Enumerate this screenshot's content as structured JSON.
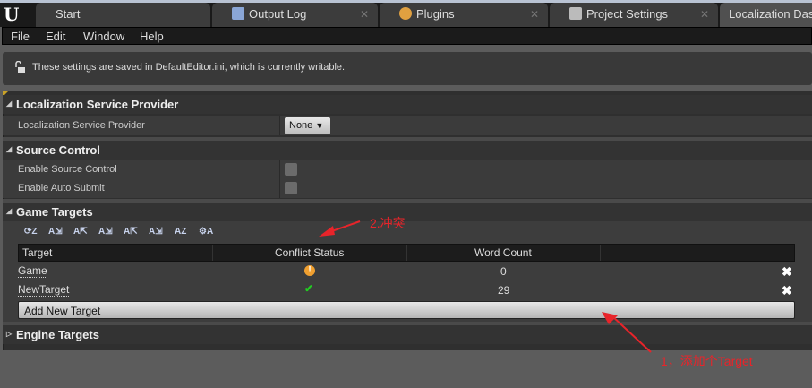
{
  "tabs": [
    {
      "label": "Start"
    },
    {
      "label": "Output Log"
    },
    {
      "label": "Plugins"
    },
    {
      "label": "Project Settings"
    },
    {
      "label": "Localization Dash"
    }
  ],
  "menu": [
    "File",
    "Edit",
    "Window",
    "Help"
  ],
  "notice": "These settings are saved in DefaultEditor.ini, which is currently writable.",
  "sections": {
    "lsp": {
      "title": "Localization Service Provider",
      "row_label": "Localization Service Provider",
      "value": "None"
    },
    "sc": {
      "title": "Source Control",
      "enable_sc": "Enable Source Control",
      "enable_as": "Enable Auto Submit",
      "enable_sc_checked": false,
      "enable_as_checked": false
    },
    "gt": {
      "title": "Game Targets",
      "columns": [
        "Target",
        "Conflict Status",
        "Word Count"
      ],
      "rows": [
        {
          "target": "Game",
          "conflict": "warning",
          "words": "0"
        },
        {
          "target": "NewTarget",
          "conflict": "ok",
          "words": "29"
        }
      ],
      "add_label": "Add New Target"
    },
    "et": {
      "title": "Engine Targets"
    }
  },
  "annotations": {
    "conflict": "2.冲突",
    "add": "1，添加个Target"
  },
  "colors": {
    "warning": "#f0a030",
    "ok": "#22cc22",
    "annotation": "#e8242a"
  }
}
